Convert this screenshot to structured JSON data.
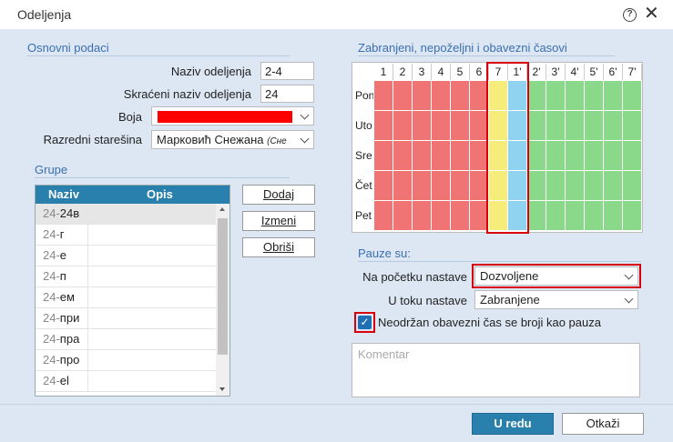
{
  "window": {
    "title": "Odeljenja"
  },
  "basic": {
    "header": "Osnovni podaci",
    "name_label": "Naziv odeljenja",
    "name_value": "2-4",
    "short_label": "Skraćeni naziv odeljenja",
    "short_value": "24",
    "color_label": "Boja",
    "color_value": "#ff0000",
    "teacher_label": "Razredni starešina",
    "teacher_value": "Марковић Снежана",
    "teacher_suffix": "(Сне"
  },
  "groups": {
    "header": "Grupe",
    "columns": [
      "Naziv",
      "Opis"
    ],
    "rows": [
      {
        "prefix": "24-",
        "name": "24в",
        "desc": ""
      },
      {
        "prefix": "24-",
        "name": "г",
        "desc": ""
      },
      {
        "prefix": "24-",
        "name": "е",
        "desc": ""
      },
      {
        "prefix": "24-",
        "name": "п",
        "desc": ""
      },
      {
        "prefix": "24-",
        "name": "ем",
        "desc": ""
      },
      {
        "prefix": "24-",
        "name": "при",
        "desc": ""
      },
      {
        "prefix": "24-",
        "name": "пра",
        "desc": ""
      },
      {
        "prefix": "24-",
        "name": "про",
        "desc": ""
      },
      {
        "prefix": "24-",
        "name": "el",
        "desc": ""
      }
    ],
    "buttons": {
      "add": "Dodaj",
      "edit": "Izmeni",
      "delete": "Obriši"
    }
  },
  "schedule": {
    "header": "Zabranjeni, nepoželjni i obavezni časovi",
    "columns": [
      "1",
      "2",
      "3",
      "4",
      "5",
      "6",
      "7",
      "1'",
      "2'",
      "3'",
      "4'",
      "5'",
      "6'",
      "7'"
    ],
    "days": [
      "Pon",
      "Uto",
      "Sre",
      "Čet",
      "Pet"
    ],
    "column_types": [
      "forbidden",
      "forbidden",
      "forbidden",
      "forbidden",
      "forbidden",
      "forbidden",
      "undesired",
      "mandatory",
      "allowed",
      "allowed",
      "allowed",
      "allowed",
      "allowed",
      "allowed"
    ],
    "colors": {
      "forbidden": "#f07474",
      "undesired": "#f5ec7a",
      "mandatory": "#8fd3f0",
      "allowed": "#8ad88a"
    }
  },
  "pauses": {
    "header": "Pauze su:",
    "start_label": "Na početku nastave",
    "start_value": "Dozvoljene",
    "during_label": "U toku nastave",
    "during_value": "Zabranjene",
    "checkbox_label": "Neodržan obavezni čas se broji kao pauza",
    "checkbox_checked": true,
    "comment_placeholder": "Komentar"
  },
  "footer": {
    "ok": "U redu",
    "cancel": "Otkaži"
  }
}
